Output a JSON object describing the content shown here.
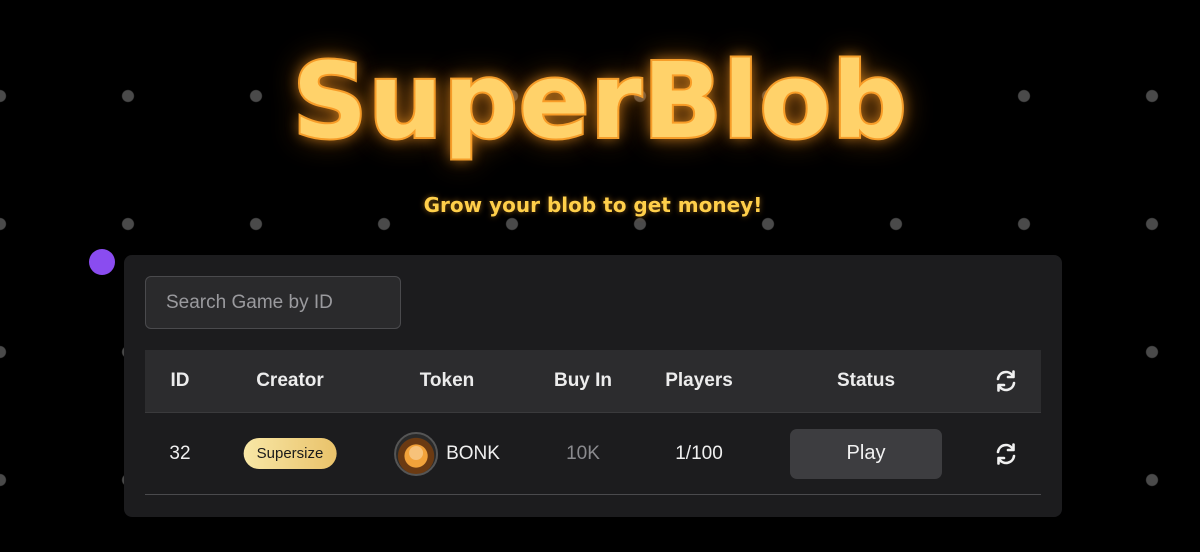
{
  "app": {
    "title": "SuperBlob",
    "subtitle": "Grow your blob to get money!"
  },
  "search": {
    "placeholder": "Search Game by ID",
    "value": ""
  },
  "table": {
    "headers": {
      "id": "ID",
      "creator": "Creator",
      "token": "Token",
      "buy_in": "Buy In",
      "players": "Players",
      "status": "Status",
      "refresh_icon": "refresh-icon"
    },
    "rows": [
      {
        "id": "32",
        "creator": "Supersize",
        "token": "BONK",
        "token_icon": "bonk-token-icon",
        "buy_in": "10K",
        "players": "1/100",
        "status_action": "Play",
        "refresh_icon": "refresh-icon"
      }
    ]
  },
  "colors": {
    "background": "#000000",
    "panel": "#1c1c1e",
    "title": "#ffd26a",
    "player_dot": "#8a4cf0",
    "creator_badge": "#f0d28a"
  }
}
